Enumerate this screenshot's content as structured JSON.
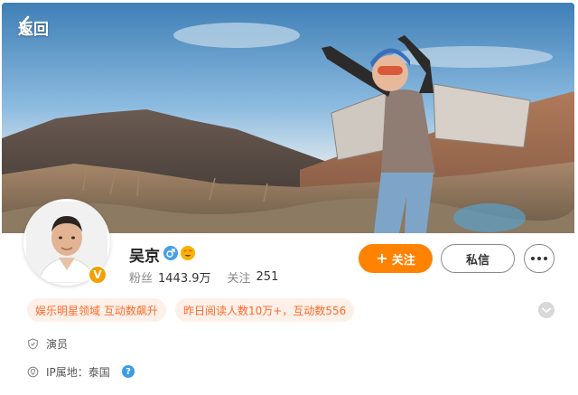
{
  "header": {
    "back_label": "返回",
    "back_icon": "chevron-left-icon"
  },
  "profile": {
    "name": "吴京",
    "verified_badge": "V",
    "verified_color": "#f4a000",
    "gender_icon": "male-gender-icon",
    "emoji_icon": "emoji-badge-icon",
    "followers_label": "粉丝",
    "followers_value": "1443.9万",
    "following_label": "关注",
    "following_value": "251"
  },
  "actions": {
    "follow_label": "关注",
    "follow_icon": "plus-icon",
    "follow_color": "#ff8200",
    "message_label": "私信",
    "more_icon": "more-dots-icon"
  },
  "tags": [
    {
      "label": "娱乐明星领域 互动数飙升"
    },
    {
      "label": "昨日阅读人数10万+，互动数556"
    }
  ],
  "tag_color": "#ff6a2a",
  "info": {
    "occupation_icon": "shield-icon",
    "occupation": "演员",
    "ip_icon": "location-icon",
    "ip_label": "IP属地：泰国",
    "help_icon": "question-icon",
    "help_glyph": "?"
  }
}
